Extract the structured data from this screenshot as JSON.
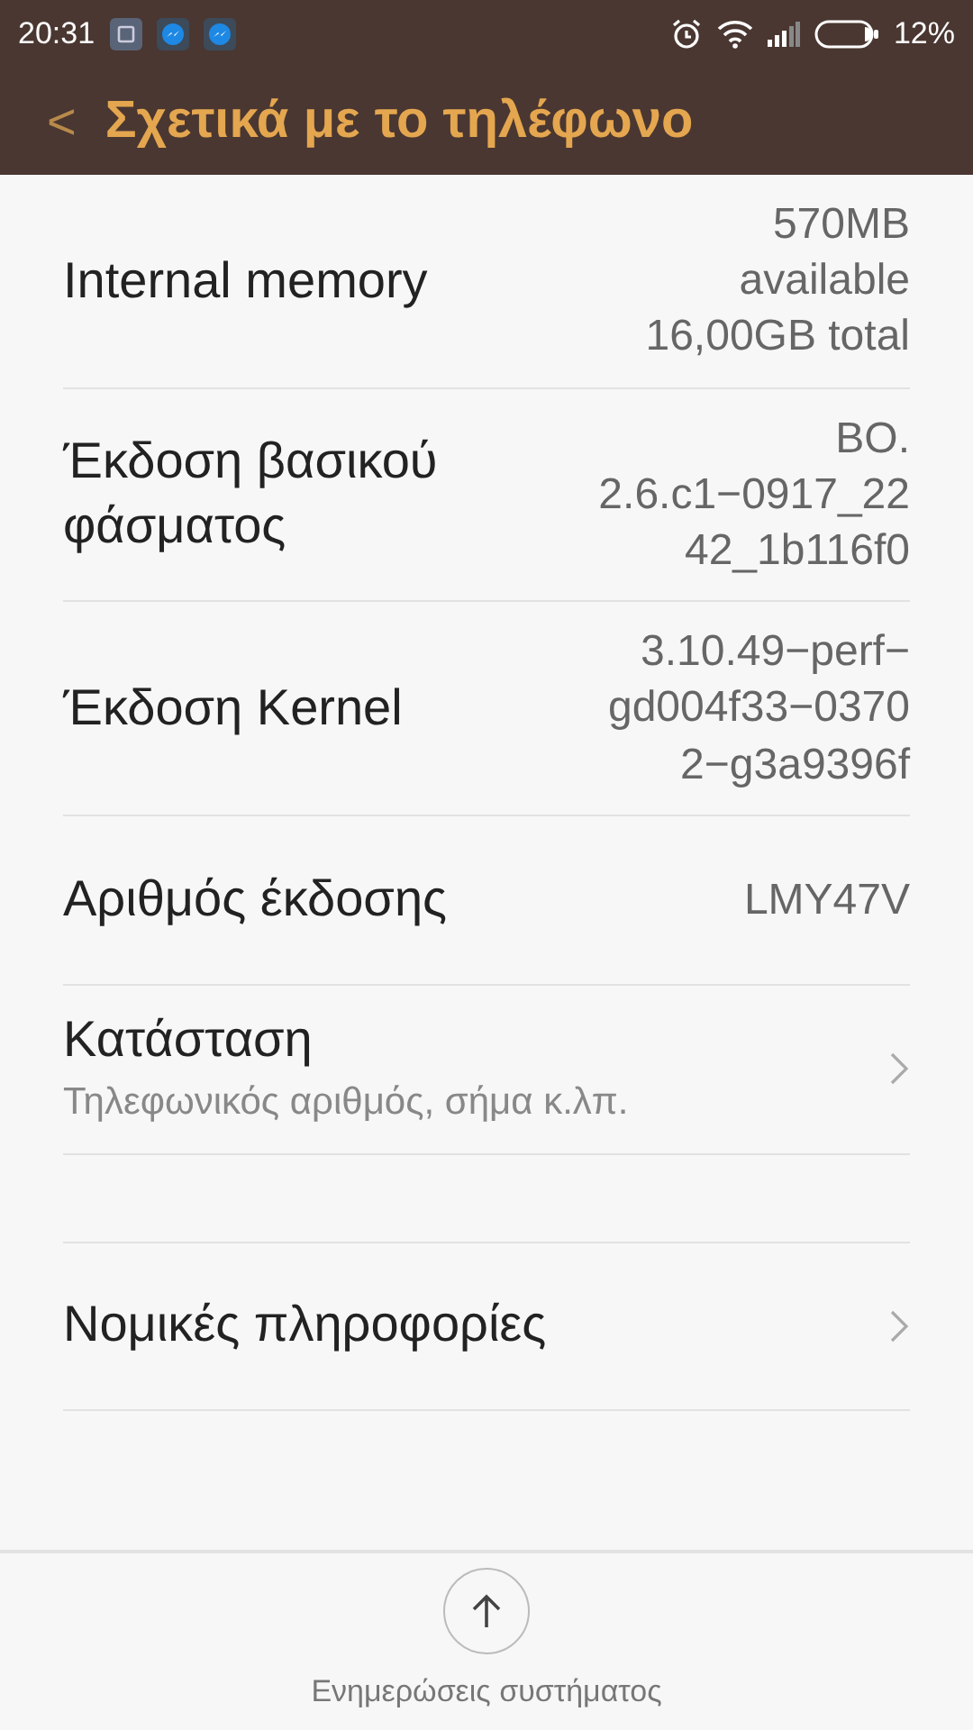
{
  "status_bar": {
    "time": "20:31",
    "notifications": [
      {
        "kind": "app"
      },
      {
        "kind": "messenger"
      },
      {
        "kind": "messenger"
      }
    ],
    "battery": "12%"
  },
  "header": {
    "back": "<",
    "title": "Σχετικά με το τηλέφωνο"
  },
  "sections": [
    {
      "items": [
        {
          "kind": "info",
          "label": "Internal memory",
          "value": [
            "570MB",
            "available",
            "16,00GB total"
          ]
        },
        {
          "kind": "info",
          "label": "Έκδοση βασικού φάσματος",
          "value": [
            "BO.",
            "2.6.c1−0917_22",
            "42_1b116f0"
          ]
        },
        {
          "kind": "info",
          "label": "Έκδοση Kernel",
          "value": [
            "3.10.49−perf−",
            "gd004f33−0370",
            "2−g3a9396f"
          ]
        },
        {
          "kind": "info",
          "label": "Αριθμός έκδοσης",
          "value": [
            "LMY47V"
          ]
        },
        {
          "kind": "link",
          "label": "Κατάσταση",
          "subtitle": "Τηλεφωνικός αριθμός, σήμα κ.λπ."
        }
      ]
    },
    {
      "items": [
        {
          "kind": "link",
          "label": "Νομικές πληροφορίες"
        }
      ]
    }
  ],
  "bottom_action": {
    "label": "Ενημερώσεις συστήματος"
  }
}
